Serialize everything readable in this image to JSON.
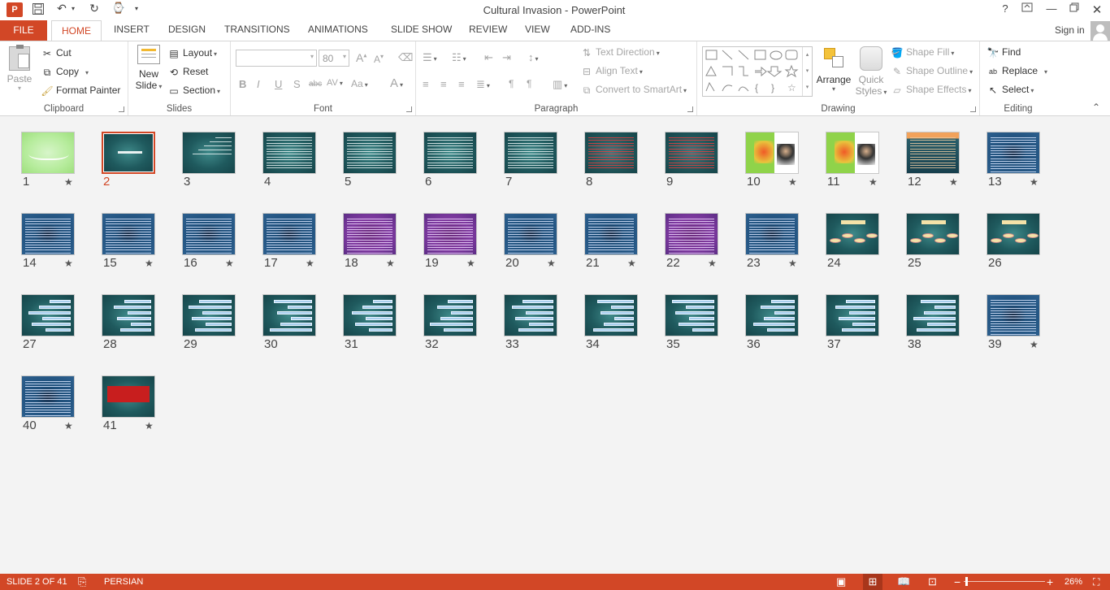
{
  "window": {
    "title": "Cultural Invasion - PowerPoint",
    "help": "?"
  },
  "tabs": [
    "FILE",
    "HOME",
    "INSERT",
    "DESIGN",
    "TRANSITIONS",
    "ANIMATIONS",
    "SLIDE SHOW",
    "REVIEW",
    "VIEW",
    "ADD-INS"
  ],
  "account": {
    "sign_in": "Sign in"
  },
  "clipboard": {
    "paste": "Paste",
    "cut": "Cut",
    "copy": "Copy",
    "format_painter": "Format Painter",
    "label": "Clipboard"
  },
  "slides": {
    "new_slide_1": "New",
    "new_slide_2": "Slide",
    "layout": "Layout",
    "reset": "Reset",
    "section": "Section",
    "label": "Slides"
  },
  "font": {
    "name": "",
    "size": "80",
    "label": "Font"
  },
  "paragraph": {
    "text_direction": "Text Direction",
    "align_text": "Align Text",
    "convert_smartart": "Convert to SmartArt",
    "label": "Paragraph"
  },
  "drawing": {
    "arrange": "Arrange",
    "quick_styles_1": "Quick",
    "quick_styles_2": "Styles",
    "shape_fill": "Shape Fill",
    "shape_outline": "Shape Outline",
    "shape_effects": "Shape Effects",
    "label": "Drawing"
  },
  "editing": {
    "find": "Find",
    "replace": "Replace",
    "select": "Select",
    "label": "Editing"
  },
  "status": {
    "slide_info": "SLIDE 2 OF 41",
    "language": "PERSIAN",
    "zoom": "26%"
  },
  "colors": {
    "accent": "#d24726",
    "slide_bg": "#1f5a5e"
  },
  "slides_list": [
    {
      "n": "1",
      "star": true,
      "style": "green-title"
    },
    {
      "n": "2",
      "star": false,
      "style": "title",
      "selected": true
    },
    {
      "n": "3",
      "star": false,
      "style": "text-sparse"
    },
    {
      "n": "4",
      "star": false,
      "style": "text"
    },
    {
      "n": "5",
      "star": false,
      "style": "text"
    },
    {
      "n": "6",
      "star": false,
      "style": "text"
    },
    {
      "n": "7",
      "star": false,
      "style": "text"
    },
    {
      "n": "8",
      "star": false,
      "style": "red-text"
    },
    {
      "n": "9",
      "star": false,
      "style": "red-text"
    },
    {
      "n": "10",
      "star": true,
      "style": "photo"
    },
    {
      "n": "11",
      "star": true,
      "style": "photo"
    },
    {
      "n": "12",
      "star": true,
      "style": "orange-text"
    },
    {
      "n": "13",
      "star": true,
      "style": "blue-dense"
    },
    {
      "n": "14",
      "star": true,
      "style": "blue-dense"
    },
    {
      "n": "15",
      "star": true,
      "style": "blue-dense"
    },
    {
      "n": "16",
      "star": true,
      "style": "blue-dense"
    },
    {
      "n": "17",
      "star": true,
      "style": "blue-dense"
    },
    {
      "n": "18",
      "star": true,
      "style": "purple-dense"
    },
    {
      "n": "19",
      "star": true,
      "style": "purple-dense"
    },
    {
      "n": "20",
      "star": true,
      "style": "blue-dense"
    },
    {
      "n": "21",
      "star": true,
      "style": "blue-dense"
    },
    {
      "n": "22",
      "star": true,
      "style": "purple-dense"
    },
    {
      "n": "23",
      "star": true,
      "style": "blue-dense"
    },
    {
      "n": "24",
      "star": false,
      "style": "diagram"
    },
    {
      "n": "25",
      "star": false,
      "style": "diagram"
    },
    {
      "n": "26",
      "star": false,
      "style": "diagram"
    },
    {
      "n": "27",
      "star": false,
      "style": "bars"
    },
    {
      "n": "28",
      "star": false,
      "style": "bars"
    },
    {
      "n": "29",
      "star": false,
      "style": "bars"
    },
    {
      "n": "30",
      "star": false,
      "style": "bars"
    },
    {
      "n": "31",
      "star": false,
      "style": "bars"
    },
    {
      "n": "32",
      "star": false,
      "style": "bars"
    },
    {
      "n": "33",
      "star": false,
      "style": "bars"
    },
    {
      "n": "34",
      "star": false,
      "style": "bars"
    },
    {
      "n": "35",
      "star": false,
      "style": "bars"
    },
    {
      "n": "36",
      "star": false,
      "style": "bars"
    },
    {
      "n": "37",
      "star": false,
      "style": "bars"
    },
    {
      "n": "38",
      "star": false,
      "style": "bars"
    },
    {
      "n": "39",
      "star": true,
      "style": "blue-dense"
    },
    {
      "n": "40",
      "star": true,
      "style": "blue-dense"
    },
    {
      "n": "41",
      "star": true,
      "style": "red-box"
    }
  ]
}
